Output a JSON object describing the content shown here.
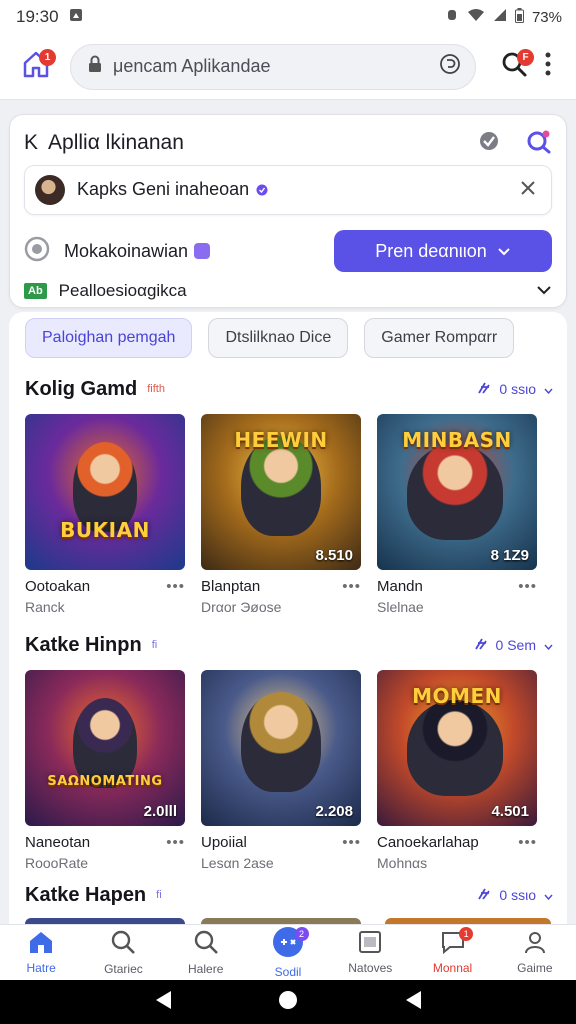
{
  "status_bar": {
    "time": "19:30",
    "battery": "73%"
  },
  "top_bar": {
    "home_badge": "1",
    "search_text": "μencam Aplikandae",
    "search_badge": "F"
  },
  "filter_panel": {
    "title": "Aplliα lkinanan",
    "key_glyph": "K",
    "search_value": "Kapks Geni inaheoan",
    "option_label": "Mokakoinawian",
    "primary_button": "Pren deαnιιon",
    "row3_tag": "Ab",
    "row3_label": "Pealloesioαgikca"
  },
  "chips": [
    "Paloighan pemgah",
    "Dtslilknao  Dice",
    "Gamer Rompαrr"
  ],
  "sections": [
    {
      "name": "Kolig Gamd",
      "tag": "fifth",
      "see_all": "0 ssιo",
      "cards": [
        {
          "title": "Ootoakan",
          "sub": "Ranck",
          "logo": "BUKIAN",
          "badge": "",
          "theme": [
            "#1c3a8a",
            "#6b2a9b",
            "#e86b2a"
          ],
          "hair": "#e2602a"
        },
        {
          "title": "Blanptan",
          "sub": "Drαor Эøose",
          "logo": "HEEWIN",
          "badge": "8.510",
          "theme": [
            "#3d2a15",
            "#a56c1c",
            "#f2c04a"
          ],
          "hair": "#5b8a2a"
        },
        {
          "title": "Mandn",
          "sub": "Slelnae",
          "logo": "MINBASN",
          "badge": "8 1Z9",
          "theme": [
            "#16334d",
            "#3f6c8c",
            "#c94a3a"
          ],
          "hair": "#c63a32"
        }
      ]
    },
    {
      "name": "Katke Hinpn",
      "tag": "fi",
      "see_all": "0 Sem",
      "cards": [
        {
          "title": "Naneotan",
          "sub": "RoooRate",
          "logo": "SAΩNOMATING",
          "badge": "2.0lll",
          "theme": [
            "#2a1a4a",
            "#8a2a5a",
            "#f06a2a"
          ],
          "hair": "#3a2a52"
        },
        {
          "title": "Upoiial",
          "sub": "Lesαn 2ase",
          "logo": "",
          "badge": "2.208",
          "theme": [
            "#1c2a4a",
            "#4a5a8a",
            "#f2d08a"
          ],
          "hair": "#b08a3a"
        },
        {
          "title": "Canoekarlahap",
          "sub": "Mohnαs",
          "logo": "MOMEN",
          "badge": "4.501",
          "theme": [
            "#3a1a3a",
            "#c24a2a",
            "#f2a02a"
          ],
          "hair": "#1a1a2a"
        }
      ]
    },
    {
      "name": "Katke Hapen",
      "tag": "fi",
      "see_all": "0 ssιo"
    }
  ],
  "bottom_nav": [
    {
      "label": "Hatre",
      "icon": "home-icon",
      "active": true
    },
    {
      "label": "Gtariec",
      "icon": "search-icon"
    },
    {
      "label": "Halere",
      "icon": "search-icon"
    },
    {
      "label": "Sodil",
      "icon": "games-icon",
      "badge": "2"
    },
    {
      "label": "Natoves",
      "icon": "news-icon"
    },
    {
      "label": "Monnal",
      "icon": "chat-icon",
      "badge": "1"
    },
    {
      "label": "Gaime",
      "icon": "profile-icon"
    }
  ],
  "colors": {
    "accent": "#5a52e6",
    "badge": "#e43a2f",
    "nav_active": "#3f6be8"
  }
}
